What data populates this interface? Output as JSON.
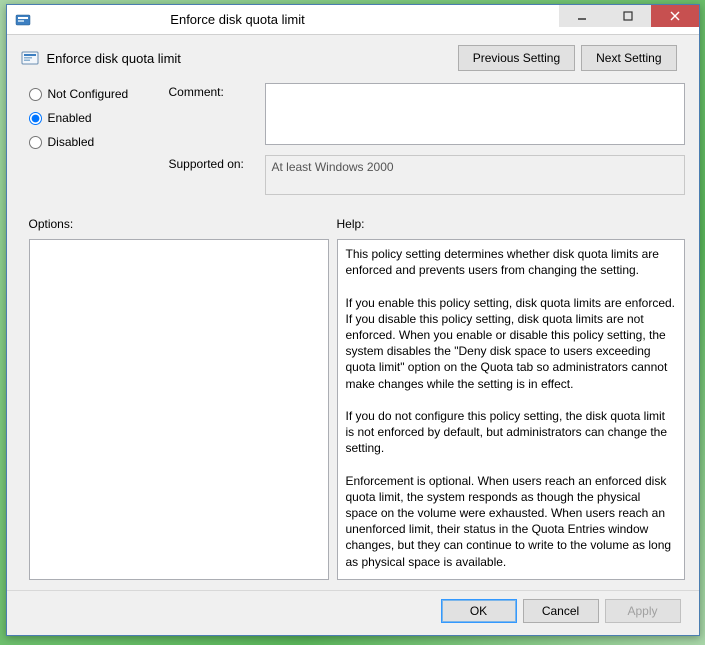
{
  "window": {
    "title": "Enforce disk quota limit"
  },
  "header": {
    "title": "Enforce disk quota limit"
  },
  "nav": {
    "previous": "Previous Setting",
    "next": "Next Setting"
  },
  "state": {
    "options": [
      {
        "value": "not-configured",
        "label": "Not Configured"
      },
      {
        "value": "enabled",
        "label": "Enabled"
      },
      {
        "value": "disabled",
        "label": "Disabled"
      }
    ],
    "selected": "enabled"
  },
  "fields": {
    "comment_label": "Comment:",
    "comment_value": "",
    "supported_label": "Supported on:",
    "supported_value": "At least Windows 2000"
  },
  "panels": {
    "options_label": "Options:",
    "help_label": "Help:"
  },
  "help_text": "This policy setting determines whether disk quota limits are enforced and prevents users from changing the setting.\n\nIf you enable this policy setting, disk quota limits are enforced. If you disable this policy setting, disk quota limits are not enforced. When you enable or disable this policy setting, the system disables the \"Deny disk space to users exceeding quota limit\" option on the Quota tab so administrators cannot make changes while the setting is in effect.\n\nIf you do not configure this policy setting, the disk quota limit is not enforced by default, but administrators can change the setting.\n\nEnforcement is optional. When users reach an enforced disk quota limit, the system responds as though the physical space on the volume were exhausted. When users reach an unenforced limit, their status in the Quota Entries window changes, but they can continue to write to the volume as long as physical space is available.",
  "footer": {
    "ok": "OK",
    "cancel": "Cancel",
    "apply": "Apply"
  }
}
